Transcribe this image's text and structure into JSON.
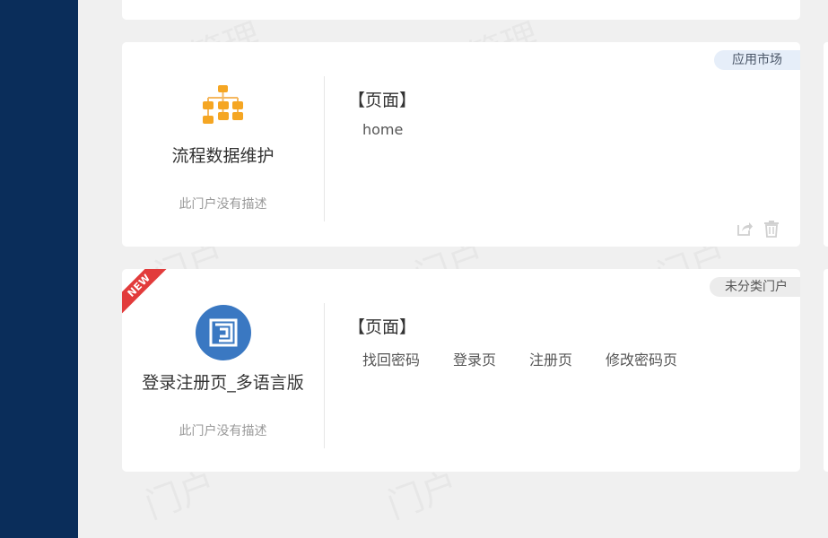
{
  "badges": {
    "market": "应用市场",
    "uncategorized": "未分类门户"
  },
  "cards": [
    {
      "name": "流程数据维护",
      "description": "此门户没有描述",
      "section_title": "【页面】",
      "pages": [
        "home"
      ],
      "icon": "flowchart-icon"
    },
    {
      "ribbon": "NEW",
      "name": "登录注册页_多语言版",
      "description": "此门户没有描述",
      "section_title": "【页面】",
      "pages": [
        "找回密码",
        "登录页",
        "注册页",
        "修改密码页"
      ],
      "icon": "login-portal-icon"
    }
  ],
  "colors": {
    "sidebar": "#0a2d5a",
    "flow_icon": "#f5a623",
    "portal_icon": "#3a78c2",
    "ribbon": "#e23b3b"
  }
}
